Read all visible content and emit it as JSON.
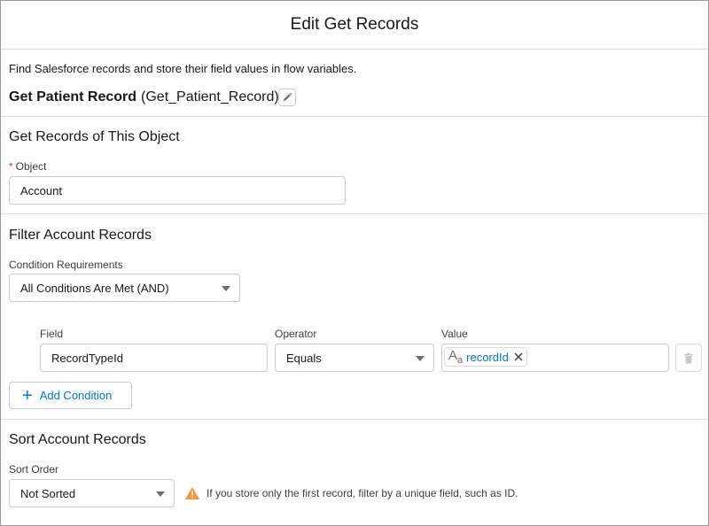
{
  "modal": {
    "title": "Edit Get Records"
  },
  "element": {
    "description": "Find Salesforce records and store their field values in flow variables.",
    "label": "Get Patient Record",
    "api_name": "(Get_Patient_Record)"
  },
  "object_section": {
    "title": "Get Records of This Object",
    "required_marker": "*",
    "object_label": "Object",
    "object_value": "Account"
  },
  "filter_section": {
    "title": "Filter Account Records",
    "requirements_label": "Condition Requirements",
    "requirements_value": "All Conditions Are Met (AND)",
    "columns": {
      "field": "Field",
      "operator": "Operator",
      "value": "Value"
    },
    "condition": {
      "field": "RecordTypeId",
      "operator": "Equals",
      "value_icon": "text-type-icon",
      "value": "recordId"
    },
    "add_condition_label": "Add Condition"
  },
  "sort_section": {
    "title": "Sort Account Records",
    "sort_order_label": "Sort Order",
    "sort_order_value": "Not Sorted",
    "warning": "If you store only the first record, filter by a unique field, such as ID."
  },
  "colors": {
    "link_blue": "#0176d3",
    "warning_orange": "#fe9339",
    "required_red": "#c23934",
    "border": "#dddbda"
  }
}
